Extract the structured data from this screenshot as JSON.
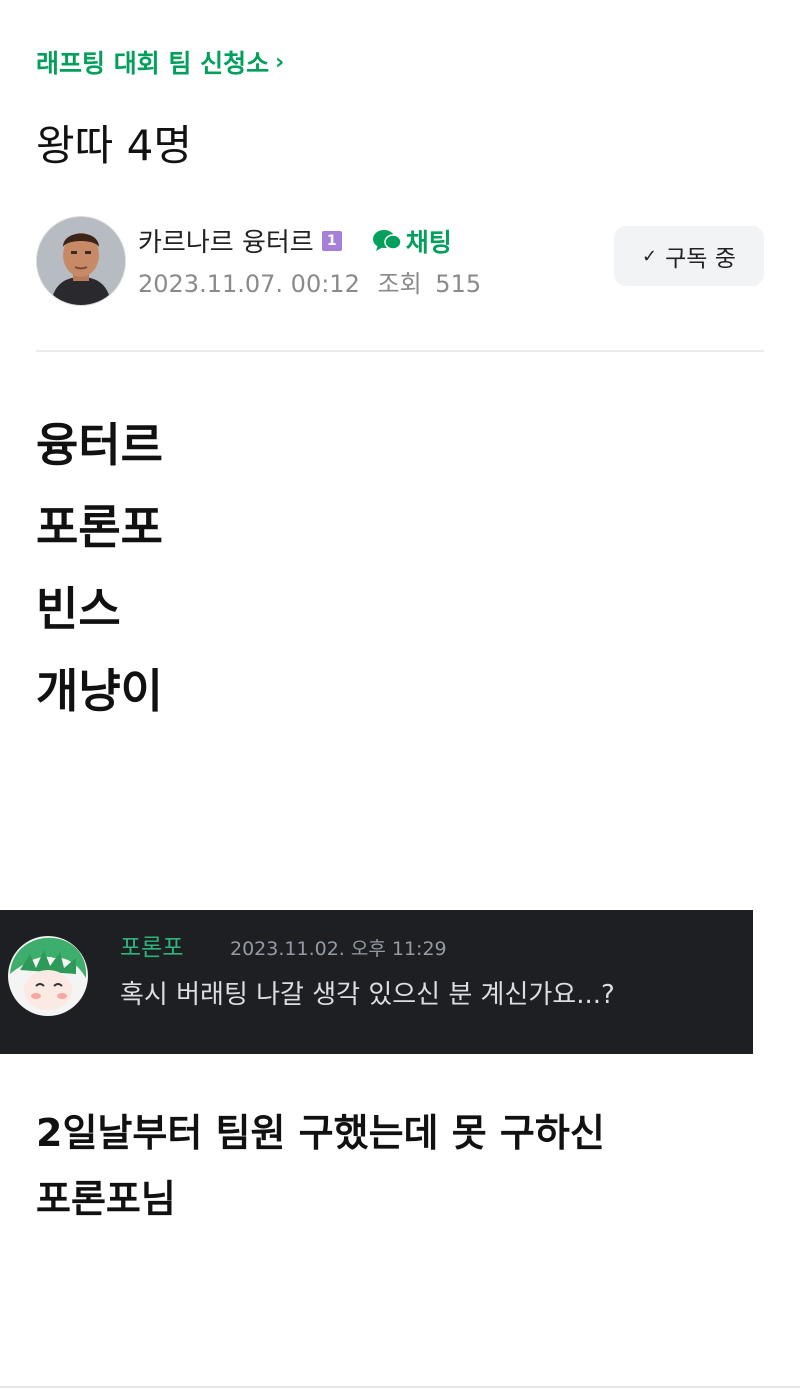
{
  "theme": {
    "accent": "#03a05c"
  },
  "board": {
    "label": "래프팅 대회 팀 신청소",
    "icon": "chevron-right-icon"
  },
  "post": {
    "title": "왕따 4명",
    "author": {
      "name": "카르나르 융터르",
      "level_badge": "1",
      "chat_label": "채팅",
      "chat_icon": "chat-bubble-icon"
    },
    "date": "2023.11.07. 00:12",
    "views_label": "조회",
    "views": "515",
    "subscribe": {
      "label": "구독 중",
      "icon": "check-icon"
    }
  },
  "body": {
    "lines": [
      "융터르",
      "포론포",
      "빈스",
      "개냥이"
    ],
    "captured_message": {
      "username": "포론포",
      "timestamp": "2023.11.02. 오후 11:29",
      "text": "혹시 버래팅 나갈 생각 있으신 분 계신가요...?"
    },
    "closing_lines": [
      "2일날부터 팀원 구했는데 못 구하신",
      "포론포님"
    ]
  }
}
